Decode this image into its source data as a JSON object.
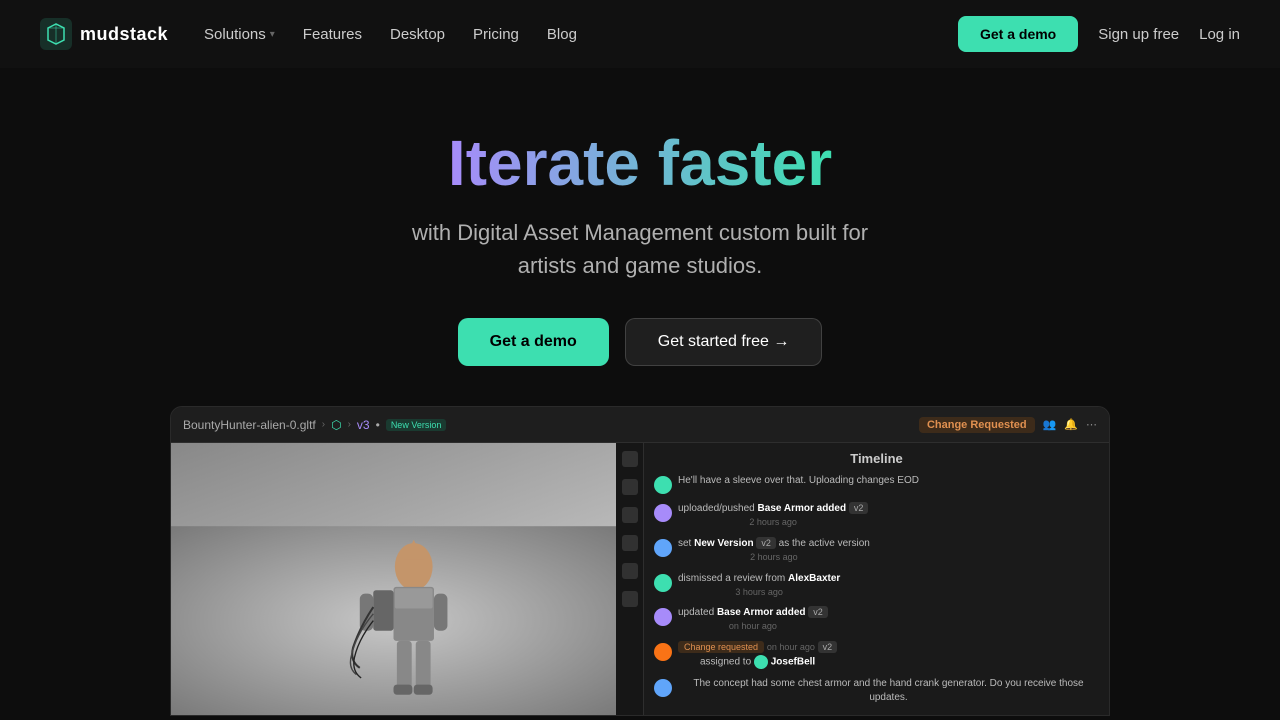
{
  "nav": {
    "logo_text": "mudstack",
    "solutions_label": "Solutions",
    "features_label": "Features",
    "desktop_label": "Desktop",
    "pricing_label": "Pricing",
    "blog_label": "Blog",
    "get_demo_label": "Get a demo",
    "sign_up_label": "Sign up free",
    "login_label": "Log in"
  },
  "hero": {
    "title": "Iterate faster",
    "subtitle_line1": "with Digital Asset Management custom built for",
    "subtitle_line2": "artists and game studios.",
    "btn_demo": "Get a demo",
    "btn_start": "Get started free →"
  },
  "screenshot": {
    "breadcrumb_file": "BountyHunter-alien-0.gltf",
    "breadcrumb_v": "v3",
    "breadcrumb_tag": "New Version",
    "change_req": "Change Requested",
    "subscribers": "Subscribers",
    "timeline_title": "Timeline",
    "timeline_items": [
      {
        "avatar_color": "av-green",
        "text": "He'll have a sleeve over that. Uploading changes EOD",
        "time": ""
      },
      {
        "avatar_color": "av-purple",
        "action": "uploaded/pushed",
        "bold": "Base Armor added",
        "badge": "v2",
        "time": "2 hours ago"
      },
      {
        "avatar_color": "av-blue",
        "action": "set",
        "bold": "New Version",
        "badge": "v2",
        "action2": "as the active version",
        "time": "2 hours ago"
      },
      {
        "avatar_color": "av-green",
        "action": "dismissed a review from",
        "bold": "AlexBaxter",
        "time": "3 hours ago"
      },
      {
        "avatar_color": "av-purple",
        "action": "updated",
        "bold": "Base Armor added",
        "badge": "v2",
        "time": "on hour ago"
      },
      {
        "avatar_color": "av-orange",
        "cr_badge": "Change requested",
        "cr_badge2": "v2",
        "assigned": "assigned to",
        "user": "JosefBell",
        "time": "on hour ago"
      },
      {
        "avatar_color": "av-blue",
        "text": "The concept had some chest armor and the hand crank generator. Do you receive those updates."
      }
    ]
  },
  "colors": {
    "accent": "#3ddfb0",
    "accent2": "#a78bfa",
    "bg": "#0d0d0d",
    "nav_bg": "#111111"
  }
}
